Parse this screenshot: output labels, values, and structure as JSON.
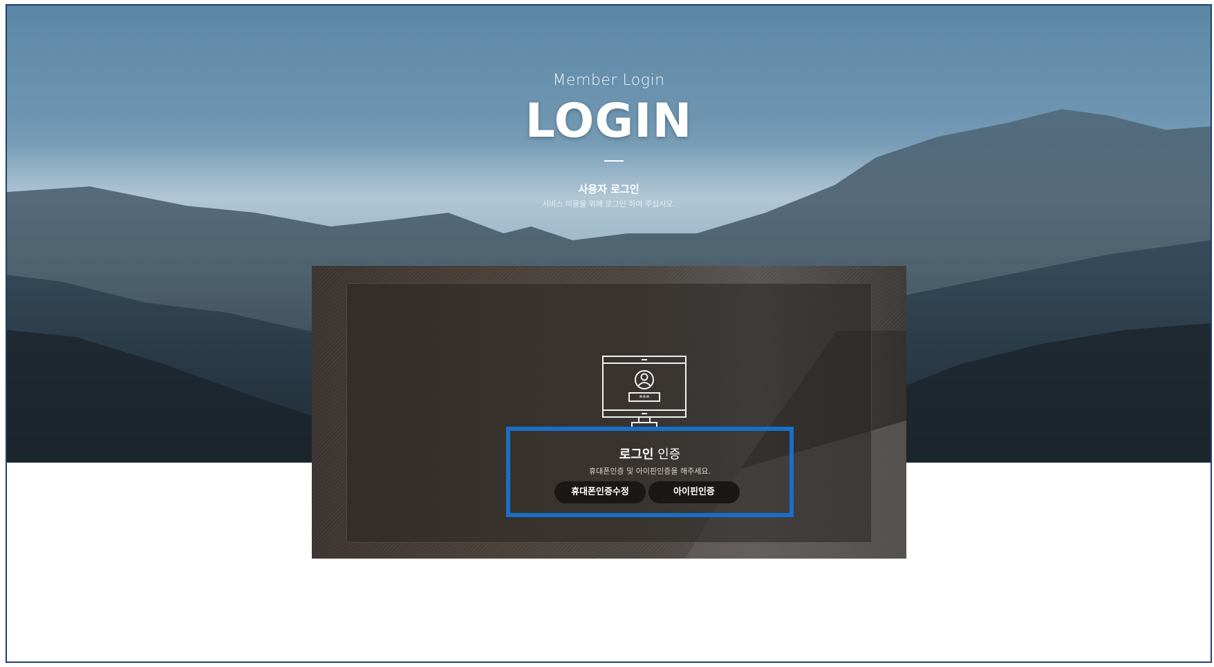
{
  "hero": {
    "subtitle": "Member Login",
    "title": "LOGIN",
    "section_title": "사용자 로그인",
    "section_desc": "서비스 이용을 위해 로그인 하여 주십시오."
  },
  "auth": {
    "title_bold": "로그인",
    "title_light": " 인증",
    "desc": "휴대폰인증 및 아이핀인증을 해주세요.",
    "buttons": {
      "phone": "휴대폰인증수정",
      "ipin": "아이핀인증"
    }
  },
  "colors": {
    "highlight_border": "#1670c8",
    "frame_border": "#1f3f6e",
    "pill_bg": "#1a1816"
  },
  "icons": {
    "monitor": "monitor-user-password-icon"
  }
}
